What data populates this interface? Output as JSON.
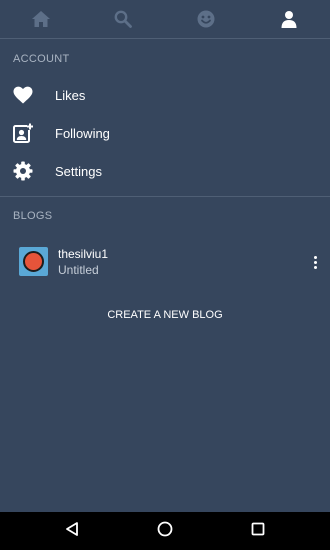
{
  "top_nav": {
    "items": [
      {
        "icon": "home-icon",
        "active": false
      },
      {
        "icon": "search-icon",
        "active": false
      },
      {
        "icon": "activity-face-icon",
        "active": false
      },
      {
        "icon": "account-icon",
        "active": true
      }
    ]
  },
  "account": {
    "header": "ACCOUNT",
    "items": [
      {
        "label": "Likes",
        "icon": "heart-icon"
      },
      {
        "label": "Following",
        "icon": "add-contact-icon"
      },
      {
        "label": "Settings",
        "icon": "gear-icon"
      }
    ]
  },
  "blogs": {
    "header": "BLOGS",
    "items": [
      {
        "name": "thesilviu1",
        "title": "Untitled"
      }
    ],
    "create_label": "CREATE A NEW BLOG"
  },
  "system_nav": {
    "items": [
      {
        "icon": "back-triangle-icon"
      },
      {
        "icon": "home-circle-icon"
      },
      {
        "icon": "recents-square-icon"
      }
    ]
  },
  "colors": {
    "background": "#36465d",
    "divider": "#4f5f75",
    "inactive_icon": "#5d6f88",
    "header_text": "#a9b4c2"
  }
}
